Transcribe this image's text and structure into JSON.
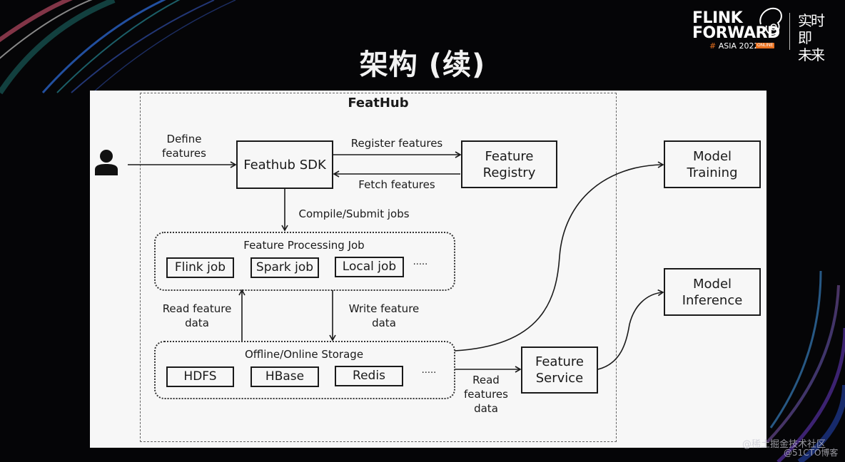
{
  "slide": {
    "title": "架构 (续)"
  },
  "logo": {
    "line1": "FLINK",
    "line2": "FORWARD",
    "hash": "#",
    "event": "ASIA 2022",
    "badge": "ONLINE",
    "cn_line1": "实时即",
    "cn_line2": "未来"
  },
  "diagram": {
    "system_title": "FeatHub",
    "user_icon": "user-icon",
    "define_features": "Define\nfeatures",
    "sdk": "Feathub SDK",
    "register_features": "Register features",
    "fetch_features": "Fetch features",
    "registry": "Feature\nRegistry",
    "compile_submit": "Compile/Submit jobs",
    "processing_group": {
      "title": "Feature Processing Job",
      "items": [
        "Flink job",
        "Spark job",
        "Local job"
      ],
      "more": "·····"
    },
    "read_feature_data": "Read feature\ndata",
    "write_feature_data": "Write feature\ndata",
    "storage_group": {
      "title": "Offline/Online Storage",
      "items": [
        "HDFS",
        "HBase",
        "Redis"
      ],
      "more": "·····"
    },
    "read_features_data": "Read\nfeatures\ndata",
    "feature_service": "Feature\nService",
    "model_training": "Model\nTraining",
    "model_inference": "Model\nInference"
  },
  "watermarks": {
    "line1": "@稀土掘金技术社区",
    "line2": "@51CTO博客"
  },
  "colors": {
    "background": "#050507",
    "panel": "#f7f7f7",
    "ink": "#1a1a1a",
    "brand_orange": "#e8701f"
  }
}
